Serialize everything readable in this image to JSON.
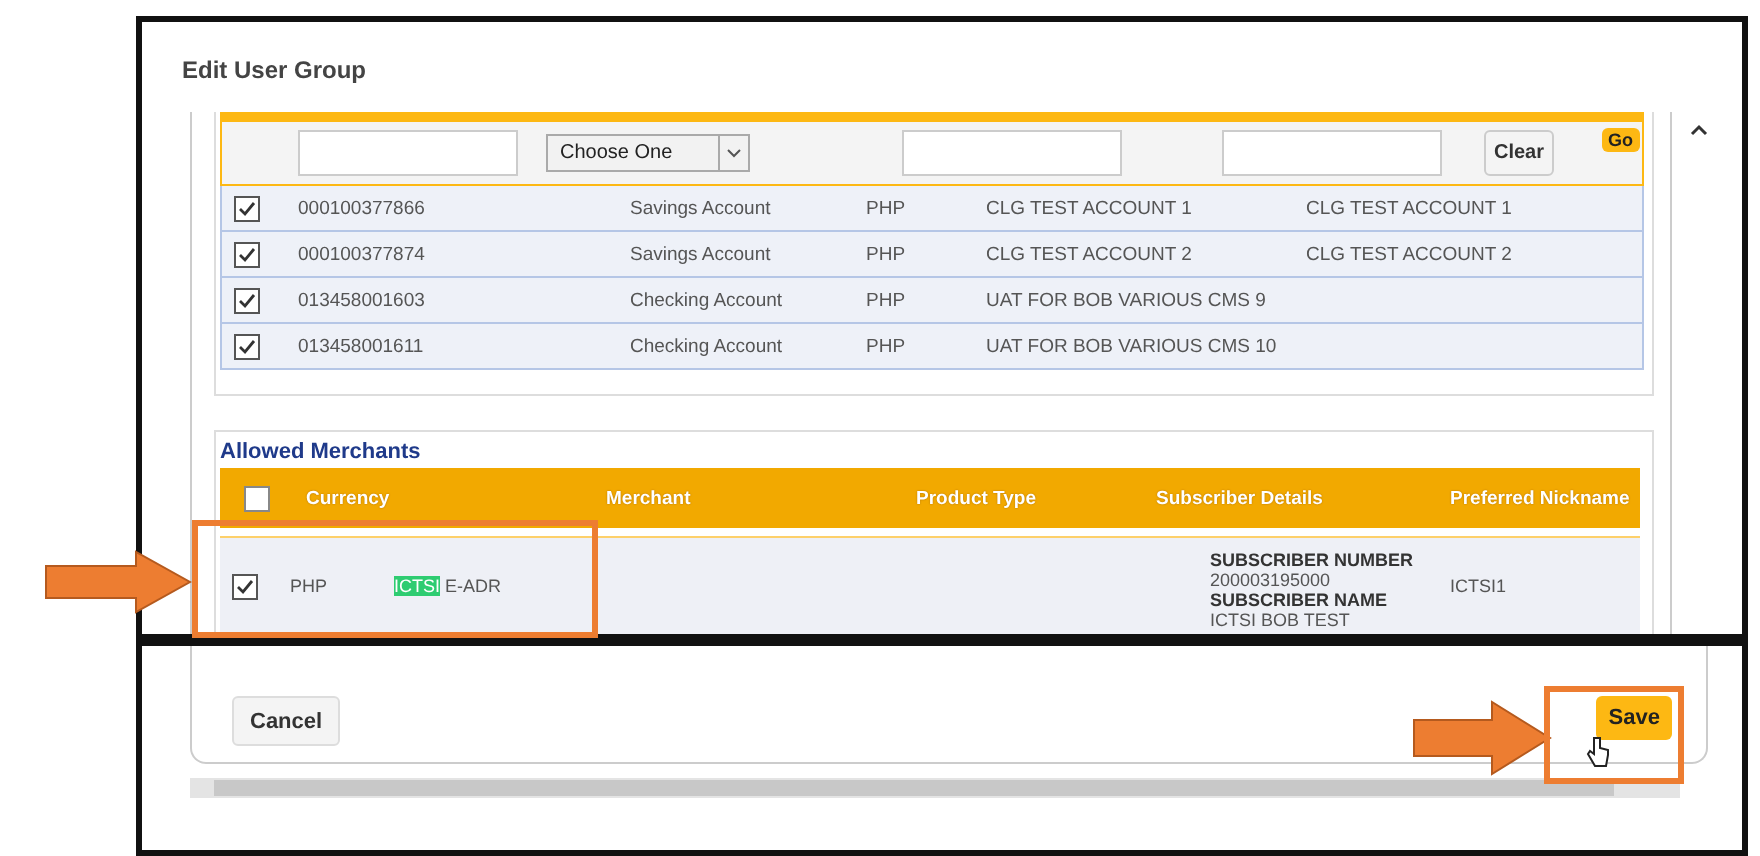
{
  "dialog": {
    "title": "Edit User Group"
  },
  "accounts_table": {
    "filters": {
      "select": "Choose One",
      "clear_button": "Clear",
      "go_button": "Go"
    },
    "rows": [
      {
        "checked": true,
        "column_1": "000100377866",
        "column_2": "Savings Account",
        "column_3": "PHP",
        "column_4": "CLG TEST ACCOUNT 1",
        "column_5": "CLG TEST ACCOUNT 1"
      },
      {
        "checked": true,
        "column_1": "000100377874",
        "column_2": "Savings Account",
        "column_3": "PHP",
        "column_4": "CLG TEST ACCOUNT 2",
        "column_5": "CLG TEST ACCOUNT 2"
      },
      {
        "checked": true,
        "column_1": "013458001603",
        "column_2": "Checking Account",
        "column_3": "PHP",
        "column_4": "UAT FOR BOB VARIOUS CMS 9",
        "column_5": ""
      },
      {
        "checked": true,
        "column_1": "013458001611",
        "column_2": "Checking Account",
        "column_3": "PHP",
        "column_4": "UAT FOR BOB VARIOUS CMS 10",
        "column_5": ""
      }
    ]
  },
  "allowed_merchants": {
    "title": "Allowed Merchants",
    "select_all_checked": false,
    "columns": [
      "Currency",
      "Merchant",
      "Product Type",
      "Subscriber Details",
      "Preferred Nickname"
    ],
    "rows": [
      {
        "checked": true,
        "currency": "PHP",
        "merchant_highlighted": "ICTSI",
        "merchant_rest": "E-ADR",
        "subscriber_details": [
          {
            "label": "SUBSCRIBER NUMBER",
            "value": "200003195000"
          },
          {
            "label": "SUBSCRIBER NAME",
            "value": "ICTSI BOB TEST"
          }
        ],
        "nickname": "ICTSI1"
      }
    ]
  },
  "footer": {
    "cancel_button": "Cancel",
    "save_button": "Save"
  }
}
